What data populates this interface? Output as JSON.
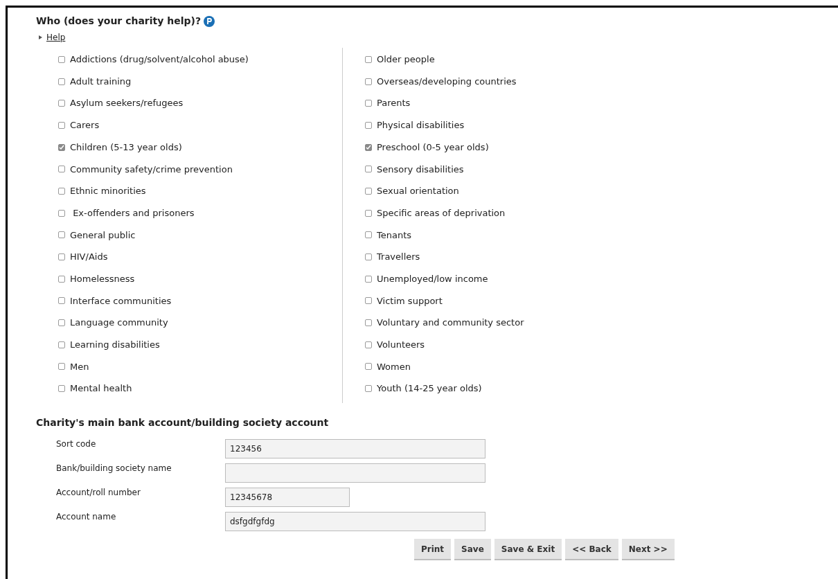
{
  "section_title": "Who (does your charity help)?",
  "help_link": "Help",
  "options_left": [
    {
      "label": "Addictions (drug/solvent/alcohol abuse)",
      "checked": false
    },
    {
      "label": "Adult training",
      "checked": false
    },
    {
      "label": "Asylum seekers/refugees",
      "checked": false
    },
    {
      "label": "Carers",
      "checked": false
    },
    {
      "label": "Children (5-13 year olds)",
      "checked": true
    },
    {
      "label": "Community safety/crime prevention",
      "checked": false
    },
    {
      "label": "Ethnic minorities",
      "checked": false
    },
    {
      "label": " Ex-offenders and prisoners",
      "checked": false
    },
    {
      "label": "General public",
      "checked": false
    },
    {
      "label": "HIV/Aids",
      "checked": false
    },
    {
      "label": "Homelessness",
      "checked": false
    },
    {
      "label": "Interface communities",
      "checked": false
    },
    {
      "label": "Language community",
      "checked": false
    },
    {
      "label": "Learning disabilities",
      "checked": false
    },
    {
      "label": "Men",
      "checked": false
    },
    {
      "label": "Mental health",
      "checked": false
    }
  ],
  "options_right": [
    {
      "label": "Older people",
      "checked": false
    },
    {
      "label": "Overseas/developing countries",
      "checked": false
    },
    {
      "label": "Parents",
      "checked": false
    },
    {
      "label": "Physical disabilities",
      "checked": false
    },
    {
      "label": "Preschool (0-5 year olds)",
      "checked": true
    },
    {
      "label": "Sensory disabilities",
      "checked": false
    },
    {
      "label": "Sexual orientation",
      "checked": false
    },
    {
      "label": "Specific areas of deprivation",
      "checked": false
    },
    {
      "label": "Tenants",
      "checked": false
    },
    {
      "label": "Travellers",
      "checked": false
    },
    {
      "label": "Unemployed/low income",
      "checked": false
    },
    {
      "label": "Victim support",
      "checked": false
    },
    {
      "label": "Voluntary and community sector",
      "checked": false
    },
    {
      "label": "Volunteers",
      "checked": false
    },
    {
      "label": "Women",
      "checked": false
    },
    {
      "label": "Youth (14-25 year olds)",
      "checked": false
    }
  ],
  "bank_title": "Charity's main bank account/building society account",
  "fields": [
    {
      "label": "Sort code",
      "value": "123456",
      "kind": "wide"
    },
    {
      "label": "Bank/building society name",
      "kind": "wide"
    },
    {
      "label": "Account/roll number",
      "value": "12345678",
      "kind": "narrow"
    },
    {
      "label": "Account name",
      "value": "dsfgdfgfdg",
      "kind": "wide"
    }
  ],
  "buttons": [
    "Print",
    "Save",
    "Save & Exit",
    "<< Back",
    "Next >>"
  ]
}
